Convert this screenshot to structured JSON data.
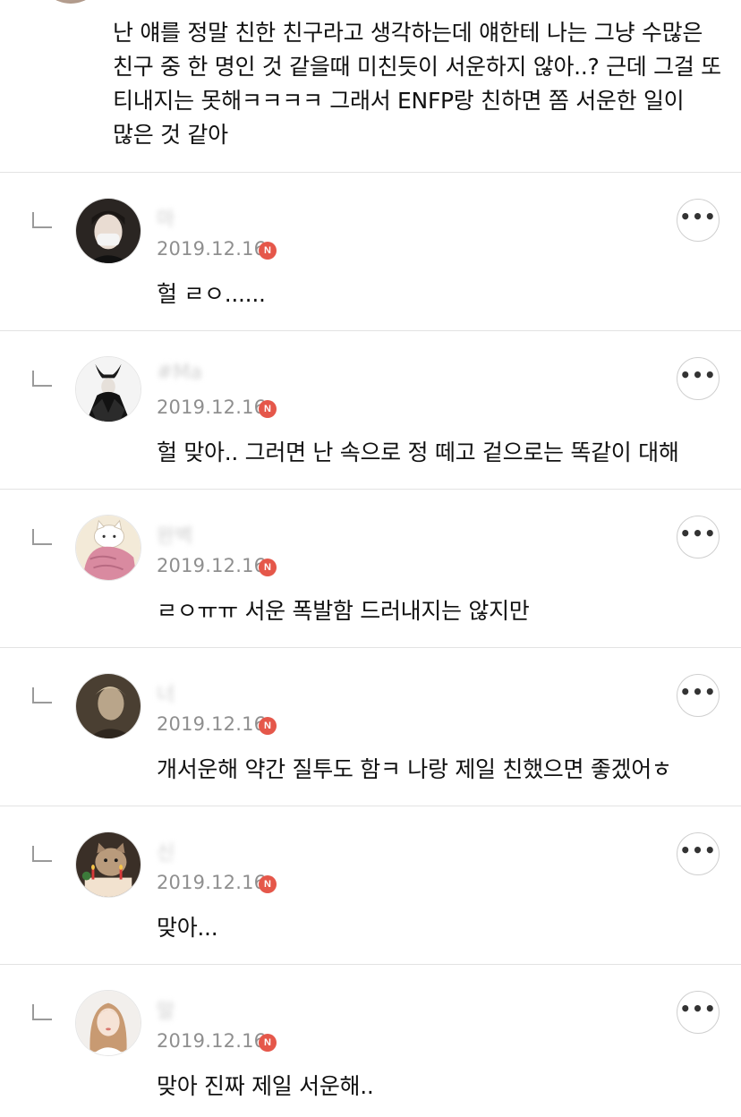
{
  "top_comment": {
    "text": "난 얘를 정말 친한 친구라고 생각하는데 얘한테 나는 그냥 수많은 친구 중 한 명인 것 같을때 미친듯이 서운하지 않아..? 근데 그걸 또 티내지는 못해ㅋㅋㅋㅋ 그래서 ENFP랑 친하면 쫌 서운한 일이 많은 것 같아"
  },
  "replies": [
    {
      "nickname": "마",
      "date": "2019.12.16",
      "badge": "N",
      "text": "헐 ㄹㅇ......",
      "avatar_icon": "masked-person-avatar"
    },
    {
      "nickname": "#Ma",
      "date": "2019.12.16",
      "badge": "N",
      "text": "헐 맞아.. 그러면 난 속으로 정 떼고 겉으로는 똑같이 대해",
      "avatar_icon": "maleficent-avatar"
    },
    {
      "nickname": "완벽",
      "date": "2019.12.16",
      "badge": "N",
      "text": "ㄹㅇㅠㅠ 서운 폭발함 드러내지는 않지만",
      "avatar_icon": "cat-blanket-avatar"
    },
    {
      "nickname": "너",
      "date": "2019.12.16",
      "badge": "N",
      "text": "개서운해 약간 질투도 함ㅋ 나랑 제일 친했으면 좋겠어ㅎ",
      "avatar_icon": "sepia-portrait-avatar"
    },
    {
      "nickname": "신",
      "date": "2019.12.16",
      "badge": "N",
      "text": "맞아...",
      "avatar_icon": "cat-cake-avatar"
    },
    {
      "nickname": "말",
      "date": "2019.12.16",
      "badge": "N",
      "text": "맞아 진짜 제일 서운해..",
      "avatar_icon": "woman-portrait-avatar"
    }
  ],
  "more_label": "•••",
  "colors": {
    "badge": "#e5574a",
    "divider": "#e3e3e3",
    "date": "#8f8f8f"
  }
}
